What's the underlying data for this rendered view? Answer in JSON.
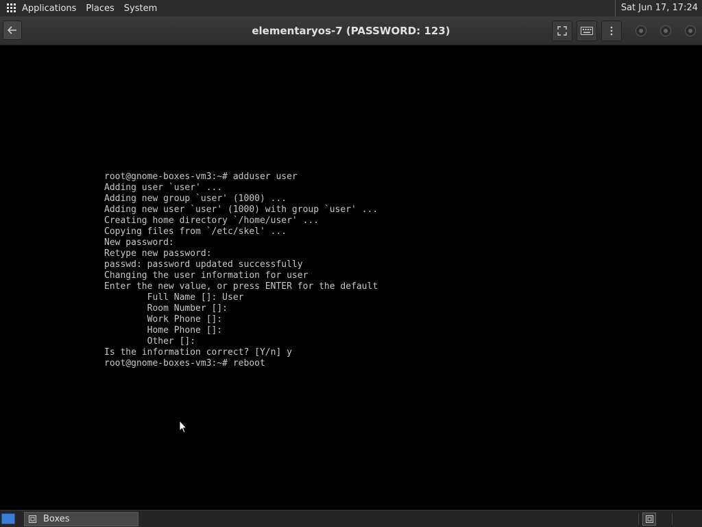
{
  "topbar": {
    "menus": [
      "Applications",
      "Places",
      "System"
    ],
    "clock": "Sat Jun 17, 17:24"
  },
  "window": {
    "title": "elementaryos-7 (PASSWORD: 123)"
  },
  "terminal": {
    "lines": [
      "root@gnome-boxes-vm3:~# adduser user",
      "Adding user `user' ...",
      "Adding new group `user' (1000) ...",
      "Adding new user `user' (1000) with group `user' ...",
      "Creating home directory `/home/user' ...",
      "Copying files from `/etc/skel' ...",
      "New password:",
      "Retype new password:",
      "passwd: password updated successfully",
      "Changing the user information for user",
      "Enter the new value, or press ENTER for the default",
      "        Full Name []: User",
      "        Room Number []:",
      "        Work Phone []:",
      "        Home Phone []:",
      "        Other []:",
      "Is the information correct? [Y/n] y",
      "root@gnome-boxes-vm3:~# reboot"
    ]
  },
  "taskbar": {
    "task_label": "Boxes"
  },
  "icons": {
    "apps": "grid-icon",
    "back": "arrow-left-icon",
    "fullscreen": "fullscreen-icon",
    "keyboard": "keyboard-icon",
    "menu": "kebab-menu-icon",
    "minimize": "minimize-icon",
    "maximize": "maximize-icon",
    "close": "close-icon"
  }
}
